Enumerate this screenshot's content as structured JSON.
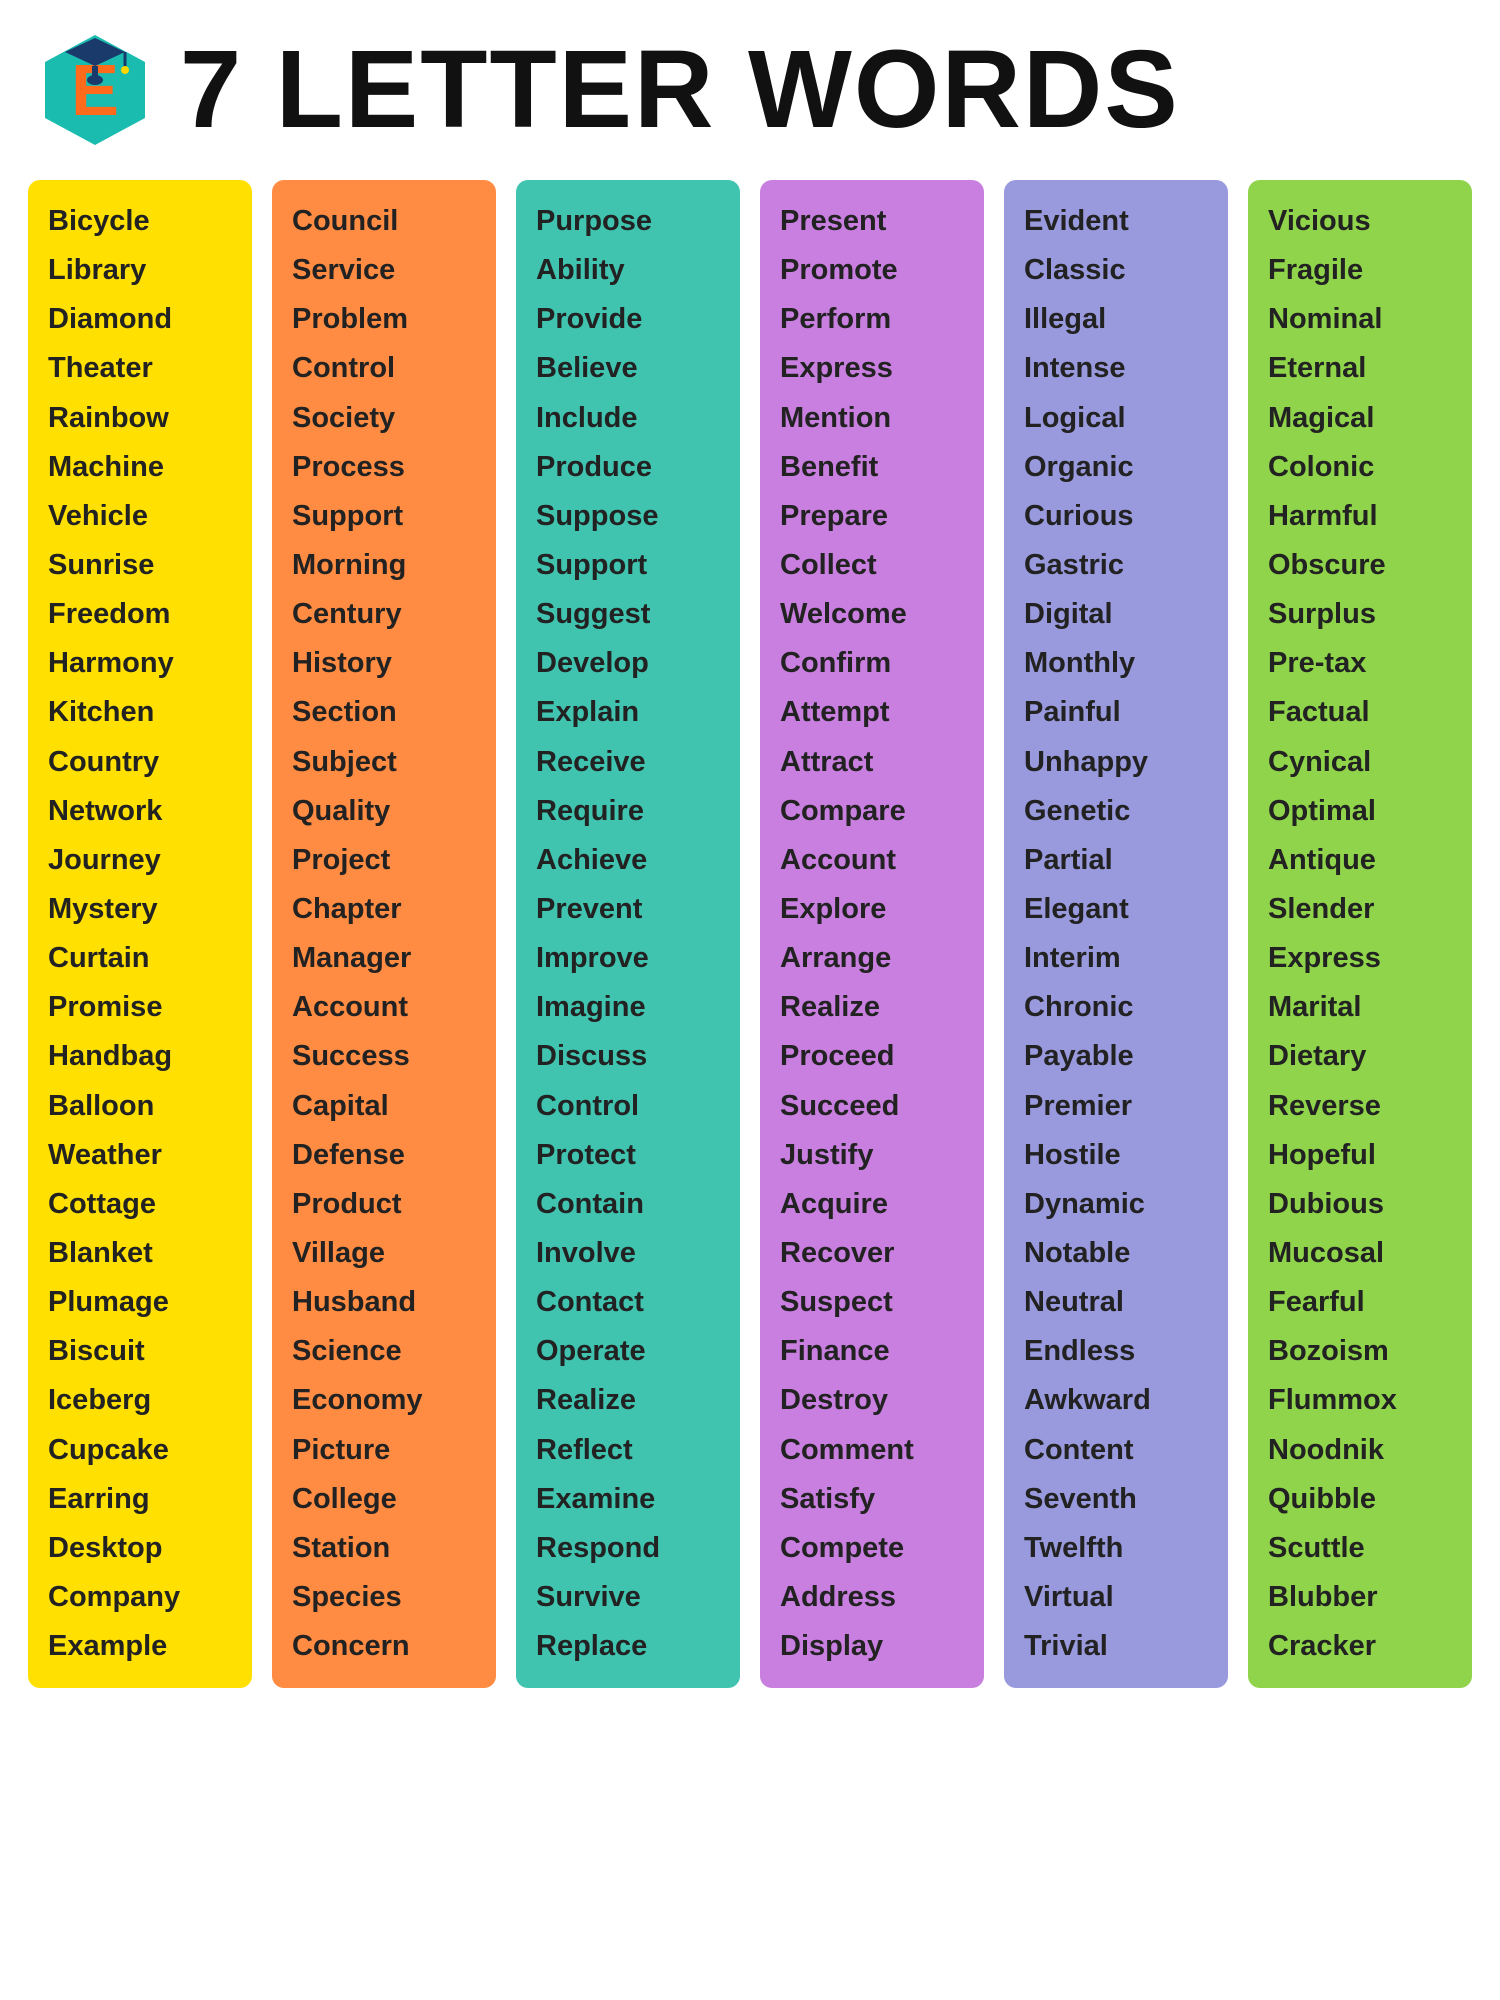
{
  "header": {
    "title": "7 LETTER WORDS"
  },
  "columns": [
    {
      "id": "col1",
      "color": "col-yellow",
      "words": [
        "Bicycle",
        "Library",
        "Diamond",
        "Theater",
        "Rainbow",
        "Machine",
        "Vehicle",
        "Sunrise",
        "Freedom",
        "Harmony",
        "Kitchen",
        "Country",
        "Network",
        "Journey",
        "Mystery",
        "Curtain",
        "Promise",
        "Handbag",
        "Balloon",
        "Weather",
        "Cottage",
        "Blanket",
        "Plumage",
        "Biscuit",
        "Iceberg",
        "Cupcake",
        "Earring",
        "Desktop",
        "Company",
        "Example"
      ]
    },
    {
      "id": "col2",
      "color": "col-orange",
      "words": [
        "Council",
        "Service",
        "Problem",
        "Control",
        "Society",
        "Process",
        "Support",
        "Morning",
        "Century",
        "History",
        "Section",
        "Subject",
        "Quality",
        "Project",
        "Chapter",
        "Manager",
        "Account",
        "Success",
        "Capital",
        "Defense",
        "Product",
        "Village",
        "Husband",
        "Science",
        "Economy",
        "Picture",
        "College",
        "Station",
        "Species",
        "Concern"
      ]
    },
    {
      "id": "col3",
      "color": "col-teal",
      "words": [
        "Purpose",
        "Ability",
        "Provide",
        "Believe",
        "Include",
        "Produce",
        "Suppose",
        "Support",
        "Suggest",
        "Develop",
        "Explain",
        "Receive",
        "Require",
        "Achieve",
        "Prevent",
        "Improve",
        "Imagine",
        "Discuss",
        "Control",
        "Protect",
        "Contain",
        "Involve",
        "Contact",
        "Operate",
        "Realize",
        "Reflect",
        "Examine",
        "Respond",
        "Survive",
        "Replace"
      ]
    },
    {
      "id": "col4",
      "color": "col-purple",
      "words": [
        "Present",
        "Promote",
        "Perform",
        "Express",
        "Mention",
        "Benefit",
        "Prepare",
        "Collect",
        "Welcome",
        "Confirm",
        "Attempt",
        "Attract",
        "Compare",
        "Account",
        "Explore",
        "Arrange",
        "Realize",
        "Proceed",
        "Succeed",
        "Justify",
        "Acquire",
        "Recover",
        "Suspect",
        "Finance",
        "Destroy",
        "Comment",
        "Satisfy",
        "Compete",
        "Address",
        "Display"
      ]
    },
    {
      "id": "col5",
      "color": "col-blue",
      "words": [
        "Evident",
        "Classic",
        "Illegal",
        "Intense",
        "Logical",
        "Organic",
        "Curious",
        "Gastric",
        "Digital",
        "Monthly",
        "Painful",
        "Unhappy",
        "Genetic",
        "Partial",
        "Elegant",
        "Interim",
        "Chronic",
        "Payable",
        "Premier",
        "Hostile",
        "Dynamic",
        "Notable",
        "Neutral",
        "Endless",
        "Awkward",
        "Content",
        "Seventh",
        "Twelfth",
        "Virtual",
        "Trivial"
      ]
    },
    {
      "id": "col6",
      "color": "col-green",
      "words": [
        "Vicious",
        "Fragile",
        "Nominal",
        "Eternal",
        "Magical",
        "Colonic",
        "Harmful",
        "Obscure",
        "Surplus",
        "Pre-tax",
        "Factual",
        "Cynical",
        "Optimal",
        "Antique",
        "Slender",
        "Express",
        "Marital",
        "Dietary",
        "Reverse",
        "Hopeful",
        "Dubious",
        "Mucosal",
        "Fearful",
        "Bozoism",
        "Flummox",
        "Noodnik",
        "Quibble",
        "Scuttle",
        "Blubber",
        "Cracker"
      ]
    }
  ]
}
